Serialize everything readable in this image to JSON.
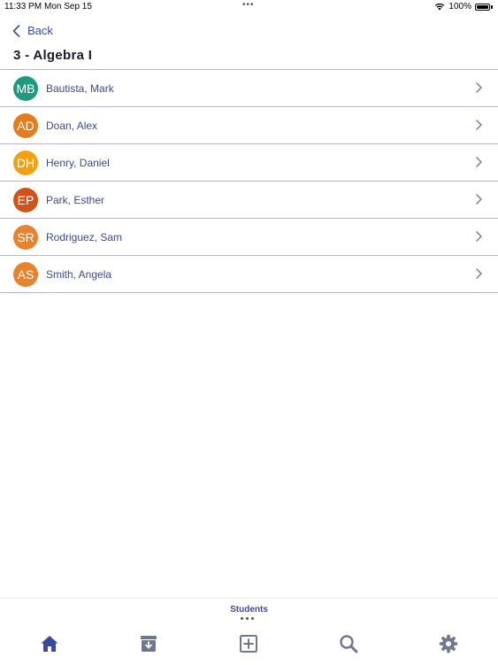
{
  "status_bar": {
    "time": "11:33 PM",
    "date": "Mon Sep 15",
    "battery": "100%"
  },
  "nav": {
    "back_label": "Back",
    "title": "3 - Algebra I"
  },
  "students": [
    {
      "initials": "MB",
      "name": "Bautista, Mark",
      "color": "#1f9a7e"
    },
    {
      "initials": "AD",
      "name": "Doan, Alex",
      "color": "#e57c1e"
    },
    {
      "initials": "DH",
      "name": "Henry, Daniel",
      "color": "#f2a112"
    },
    {
      "initials": "EP",
      "name": "Park, Esther",
      "color": "#d0531a"
    },
    {
      "initials": "SR",
      "name": "Rodriguez, Sam",
      "color": "#e8822d"
    },
    {
      "initials": "AS",
      "name": "Smith, Angela",
      "color": "#e8822d"
    }
  ],
  "tabbar": {
    "active_label": "Students",
    "tabs": [
      {
        "icon": "home-icon",
        "active": true
      },
      {
        "icon": "archive-icon",
        "active": false
      },
      {
        "icon": "add-square-icon",
        "active": false
      },
      {
        "icon": "search-icon",
        "active": false
      },
      {
        "icon": "gear-icon",
        "active": false
      }
    ],
    "active_color": "#3b4aa0",
    "inactive_color": "#6f778f"
  }
}
